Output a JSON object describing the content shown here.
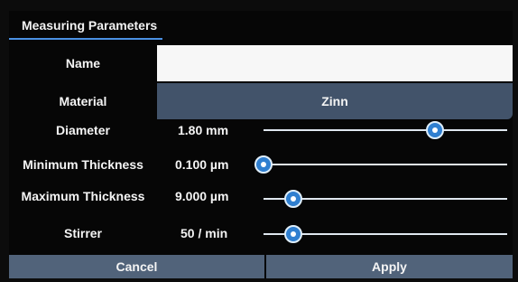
{
  "window": {
    "title": "Measuring Parameters"
  },
  "fields": {
    "name": {
      "label": "Name",
      "value": ""
    },
    "material": {
      "label": "Material",
      "value": "Zinn"
    }
  },
  "sliders": [
    {
      "label": "Diameter",
      "value": "1.80 mm",
      "position": 0.72
    },
    {
      "label": "Minimum Thickness",
      "value": "0.100 µm",
      "position": 0.0
    },
    {
      "label": "Maximum Thickness",
      "value": "9.000 µm",
      "position": 0.09
    },
    {
      "label": "Stirrer",
      "value": "50 / min",
      "position": 0.09
    }
  ],
  "buttons": {
    "cancel": "Cancel",
    "apply": "Apply"
  },
  "colors": {
    "accent": "#4a90e2",
    "panel": "#42536a",
    "button": "#51637a",
    "thumb": "#2f7fd0"
  }
}
